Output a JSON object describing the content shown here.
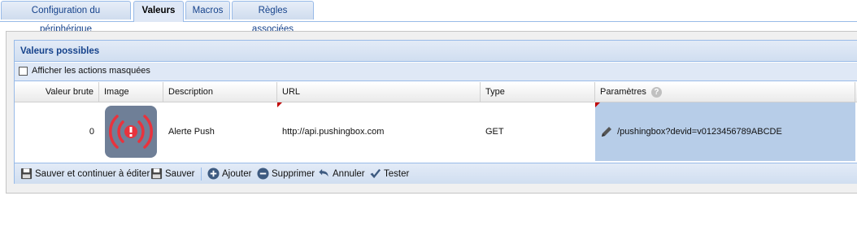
{
  "tabs": [
    {
      "label": "Configuration du périphérique"
    },
    {
      "label": "Valeurs"
    },
    {
      "label": "Macros"
    },
    {
      "label": "Règles associées"
    }
  ],
  "panel": {
    "title": "Valeurs possibles",
    "show_hidden_label": "Afficher les actions masquées",
    "show_hidden_checked": false
  },
  "grid": {
    "columns": [
      "Valeur brute",
      "Image",
      "Description",
      "URL",
      "Type",
      "Paramètres"
    ],
    "rows": [
      {
        "raw_value": "0",
        "image_icon": "alert-broadcast-icon",
        "description": "Alerte Push",
        "url": "http://api.pushingbox.com",
        "type": "GET",
        "params": "/pushingbox?devid=v0123456789ABCDE"
      }
    ]
  },
  "toolbar": {
    "save_continue": "Sauver et continuer à éditer",
    "save": "Sauver",
    "add": "Ajouter",
    "delete": "Supprimer",
    "cancel": "Annuler",
    "test": "Tester"
  },
  "colors": {
    "accent": "#15428b",
    "selected_cell": "#b7cde8",
    "alert_red": "#e8333d"
  }
}
